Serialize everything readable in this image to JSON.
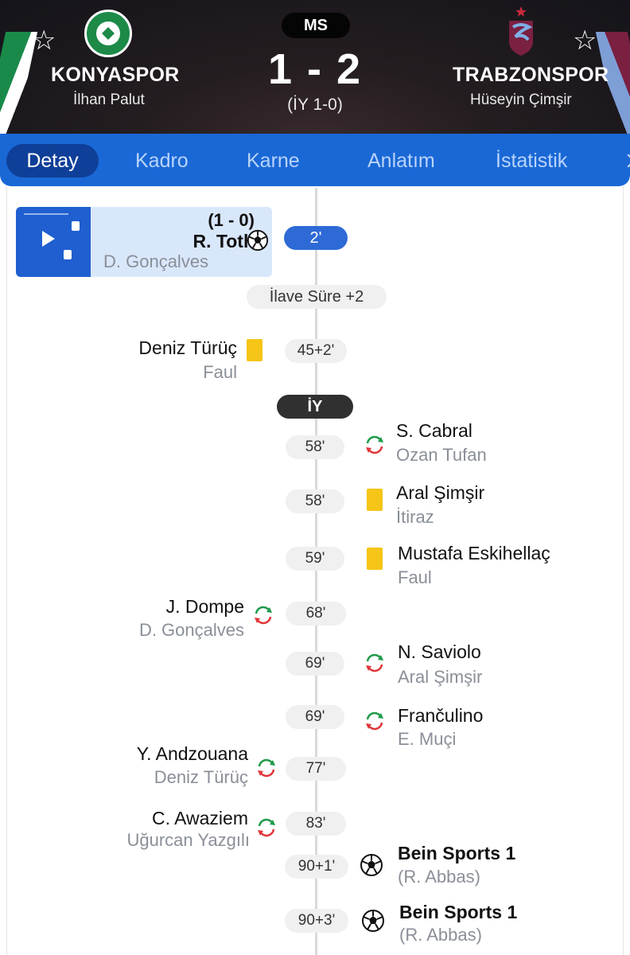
{
  "match": {
    "status": "MS",
    "score": "1 - 2",
    "halftime": "(İY 1-0)",
    "home": {
      "name": "KONYASPOR",
      "coach": "İlhan Palut"
    },
    "away": {
      "name": "TRABZONSPOR",
      "coach": "Hüseyin Çimşir"
    }
  },
  "tabs": [
    "Detay",
    "Kadro",
    "Karne",
    "Anlatım",
    "İstatistik"
  ],
  "timeline": {
    "goal1": {
      "score": "(1 - 0)",
      "scorer": "R. Toth",
      "assist": "D. Gonçalves",
      "minute": "2'"
    },
    "added_time": "İlave Süre +2",
    "card1": {
      "player": "Deniz Türüç",
      "reason": "Faul",
      "minute": "45+2'"
    },
    "half_marker": "İY",
    "sub1": {
      "in": "S. Cabral",
      "out": "Ozan Tufan",
      "minute": "58'"
    },
    "card2": {
      "player": "Aral Şimşir",
      "reason": "İtiraz",
      "minute": "58'"
    },
    "card3": {
      "player": "Mustafa Eskihellaç",
      "reason": "Faul",
      "minute": "59'"
    },
    "sub2": {
      "in": "J. Dompe",
      "out": "D. Gonçalves",
      "minute": "68'"
    },
    "sub3": {
      "in": "N. Saviolo",
      "out": "Aral Şimşir",
      "minute": "69'"
    },
    "sub4": {
      "in": "Frančulino",
      "out": "E. Muçi",
      "minute": "69'"
    },
    "sub5": {
      "in": "Y. Andzouana",
      "out": "Deniz Türüç",
      "minute": "77'"
    },
    "sub6": {
      "in": "C. Awaziem",
      "out": "Uğurcan Yazgılı",
      "minute": "83'"
    },
    "goal2": {
      "scorer": "Bein Sports 1",
      "assist": "(R. Abbas)",
      "minute": "90+1'"
    },
    "goal3": {
      "scorer": "Bein Sports 1",
      "assist": "(R. Abbas)",
      "minute": "90+3'"
    }
  },
  "colors": {
    "tab_bar": "#1a68d6",
    "active_tab": "#0f3f98",
    "yellow_card": "#f5c518"
  },
  "icons": [
    "star-icon",
    "ball-icon",
    "yellow-card-icon",
    "substitution-icon",
    "play-icon"
  ]
}
